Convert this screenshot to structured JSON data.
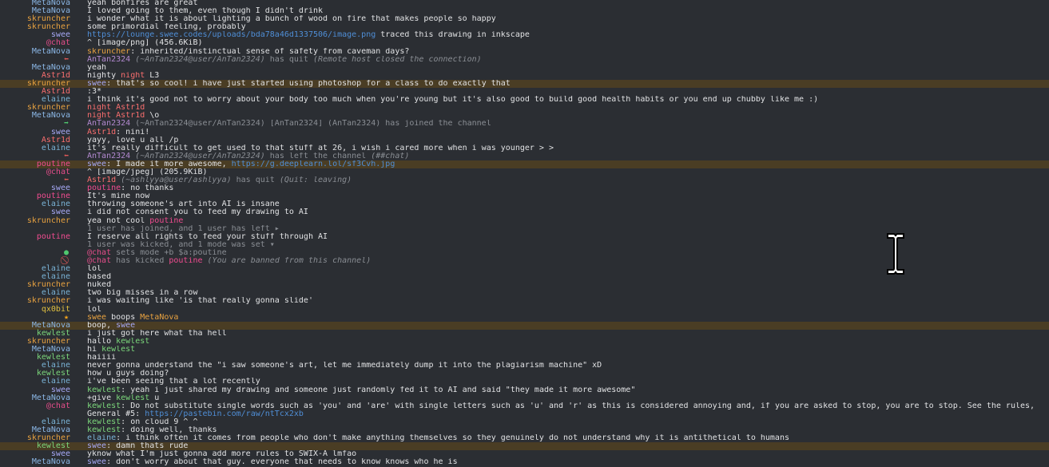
{
  "messages": [
    {
      "nick": "MetaNova",
      "nc": "c-metanova",
      "parts": [
        {
          "t": "yeah bonfires are great"
        }
      ]
    },
    {
      "nick": "MetaNova",
      "nc": "c-metanova",
      "parts": [
        {
          "t": "I loved going to them, even though I didn't drink"
        }
      ]
    },
    {
      "nick": "skruncher",
      "nc": "c-skruncher",
      "parts": [
        {
          "t": "i wonder what it is about lighting a bunch of wood on fire that makes people so happy"
        }
      ]
    },
    {
      "nick": "skruncher",
      "nc": "c-skruncher",
      "parts": [
        {
          "t": "some primordial feeling, probably"
        }
      ]
    },
    {
      "nick": "swee",
      "nc": "c-swee",
      "parts": [
        {
          "t": "https://lounge.swee.codes/uploads/bda78a46d1337506/image.png",
          "c": "url"
        },
        {
          "t": " traced this drawing in inkscape"
        }
      ]
    },
    {
      "nick": "@chat",
      "nc": "c-chat",
      "parts": [
        {
          "t": "^ [image/png] (456.6KiB)"
        }
      ]
    },
    {
      "nick": "MetaNova",
      "nc": "c-metanova",
      "parts": [
        {
          "t": "skruncher",
          "c": "c-skruncher"
        },
        {
          "t": ": inherited/instinctual sense of safety from caveman days?"
        }
      ]
    },
    {
      "icon": "quit",
      "iconName": "quit-icon",
      "parts": [
        {
          "t": "AnTan2324",
          "c": "c-antan"
        },
        {
          "t": " (~AnTan2324@user/AnTan2324)",
          "c": "status-i"
        },
        {
          "t": " has quit ",
          "c": "status"
        },
        {
          "t": "(Remote host closed the connection)",
          "c": "status-i"
        }
      ]
    },
    {
      "nick": "MetaNova",
      "nc": "c-metanova",
      "parts": [
        {
          "t": "yeah"
        }
      ]
    },
    {
      "nick": "Astr1d",
      "nc": "c-astr",
      "parts": [
        {
          "t": "nighty "
        },
        {
          "t": "night",
          "c": "c-astr"
        },
        {
          "t": " L3"
        }
      ]
    },
    {
      "nick": "skruncher",
      "nc": "c-skruncher",
      "hl": true,
      "parts": [
        {
          "t": "swee",
          "c": "c-swee"
        },
        {
          "t": ": that's so cool! i have just started using photoshop for a class to do exactly that"
        }
      ]
    },
    {
      "nick": "Astr1d",
      "nc": "c-astr",
      "parts": [
        {
          "t": ":3*"
        }
      ]
    },
    {
      "nick": "elaine",
      "nc": "c-elaine",
      "parts": [
        {
          "t": "i think it's good not to worry about your body too much when you're young but it's also good to build good health habits or you end up chubby like me :)"
        }
      ]
    },
    {
      "nick": "skruncher",
      "nc": "c-skruncher",
      "parts": [
        {
          "t": "night ",
          "c": "c-astr"
        },
        {
          "t": "Astr1d",
          "c": "c-astr"
        }
      ]
    },
    {
      "nick": "MetaNova",
      "nc": "c-metanova",
      "parts": [
        {
          "t": "night ",
          "c": "c-astr"
        },
        {
          "t": "Astr1d",
          "c": "c-astr"
        },
        {
          "t": " \\o"
        }
      ]
    },
    {
      "icon": "join",
      "iconName": "join-icon",
      "parts": [
        {
          "t": "AnTan2324",
          "c": "c-antan"
        },
        {
          "t": " (~AnTan2324@user/AnTan2324) [AnTan2324] (AnTan2324) has joined the channel",
          "c": "status"
        }
      ]
    },
    {
      "nick": "swee",
      "nc": "c-swee",
      "parts": [
        {
          "t": "Astr1d",
          "c": "c-astr"
        },
        {
          "t": ": nini!"
        }
      ]
    },
    {
      "nick": "Astr1d",
      "nc": "c-astr",
      "parts": [
        {
          "t": "yayy, love u all /p"
        }
      ]
    },
    {
      "nick": "elaine",
      "nc": "c-elaine",
      "parts": [
        {
          "t": "it's really difficult to get used to that stuff at 26, i wish i cared more when i was younger > >"
        }
      ]
    },
    {
      "icon": "quit",
      "iconName": "part-icon",
      "parts": [
        {
          "t": "AnTan2324",
          "c": "c-antan"
        },
        {
          "t": " (~AnTan2324@user/AnTan2324)",
          "c": "status-i"
        },
        {
          "t": " has left the channel ",
          "c": "status"
        },
        {
          "t": "(##chat)",
          "c": "status-i"
        }
      ]
    },
    {
      "nick": "poutine",
      "nc": "c-poutine",
      "hl": true,
      "parts": [
        {
          "t": "swee",
          "c": "c-swee"
        },
        {
          "t": ": I made it more awesome, "
        },
        {
          "t": "https://g.deeplearn.lol/sf3Cvh.jpg",
          "c": "url"
        }
      ]
    },
    {
      "nick": "@chat",
      "nc": "c-chat",
      "parts": [
        {
          "t": "^ [image/jpeg] (205.9KiB)"
        }
      ]
    },
    {
      "icon": "quit",
      "iconName": "quit-icon",
      "parts": [
        {
          "t": "Astr1d",
          "c": "c-astr"
        },
        {
          "t": " (~ashlyya@user/ashlyya)",
          "c": "status-i"
        },
        {
          "t": " has quit ",
          "c": "status"
        },
        {
          "t": "(Quit: leaving)",
          "c": "status-i"
        }
      ]
    },
    {
      "nick": "swee",
      "nc": "c-swee",
      "parts": [
        {
          "t": "poutine",
          "c": "c-poutine"
        },
        {
          "t": ": no thanks"
        }
      ]
    },
    {
      "nick": "poutine",
      "nc": "c-poutine",
      "parts": [
        {
          "t": "It's mine now"
        }
      ]
    },
    {
      "nick": "elaine",
      "nc": "c-elaine",
      "parts": [
        {
          "t": "throwing someone's art into AI is insane"
        }
      ]
    },
    {
      "nick": "swee",
      "nc": "c-swee",
      "parts": [
        {
          "t": "i did not consent you to feed my drawing to AI"
        }
      ]
    },
    {
      "nick": "skruncher",
      "nc": "c-skruncher",
      "parts": [
        {
          "t": "yea not cool "
        },
        {
          "t": "poutine",
          "c": "c-poutine"
        }
      ]
    },
    {
      "parts": [
        {
          "t": "1 user has joined, and 1 user has left ▸",
          "c": "status"
        }
      ]
    },
    {
      "nick": "poutine",
      "nc": "c-poutine",
      "parts": [
        {
          "t": "I reserve all rights to feed your stuff through AI"
        }
      ]
    },
    {
      "parts": [
        {
          "t": "1 user was kicked, and 1 mode was set ▾",
          "c": "status"
        }
      ]
    },
    {
      "icon": "info",
      "iconName": "mode-icon",
      "parts": [
        {
          "t": "@chat",
          "c": "c-chat"
        },
        {
          "t": " sets mode +b $a:poutine",
          "c": "status"
        }
      ]
    },
    {
      "icon": "kick",
      "iconName": "kick-icon",
      "parts": [
        {
          "t": "@chat",
          "c": "c-chat"
        },
        {
          "t": " has kicked ",
          "c": "status"
        },
        {
          "t": "poutine",
          "c": "c-poutine"
        },
        {
          "t": " (You are banned from this channel)",
          "c": "status-i"
        }
      ]
    },
    {
      "nick": "elaine",
      "nc": "c-elaine",
      "parts": [
        {
          "t": "lol"
        }
      ]
    },
    {
      "nick": "elaine",
      "nc": "c-elaine",
      "parts": [
        {
          "t": "based"
        }
      ]
    },
    {
      "nick": "skruncher",
      "nc": "c-skruncher",
      "parts": [
        {
          "t": "nuked"
        }
      ]
    },
    {
      "nick": "elaine",
      "nc": "c-elaine",
      "parts": [
        {
          "t": "two big misses in a row"
        }
      ]
    },
    {
      "nick": "skruncher",
      "nc": "c-skruncher",
      "parts": [
        {
          "t": "i was waiting like 'is that really gonna slide'"
        }
      ]
    },
    {
      "nick": "qx0bit",
      "nc": "c-qx",
      "parts": [
        {
          "t": "lol"
        }
      ]
    },
    {
      "icon": "star",
      "iconName": "star-icon",
      "parts": [
        {
          "t": "swee",
          "c": "c-skruncher"
        },
        {
          "t": " boops "
        },
        {
          "t": "MetaNova",
          "c": "c-skruncher"
        }
      ]
    },
    {
      "nick": "MetaNova",
      "nc": "c-metanova",
      "hl": true,
      "parts": [
        {
          "t": "boop, "
        },
        {
          "t": "swee",
          "c": "c-swee"
        }
      ]
    },
    {
      "nick": "kewlest",
      "nc": "c-kewlest",
      "parts": [
        {
          "t": "i just got here what tha hell"
        }
      ]
    },
    {
      "nick": "skruncher",
      "nc": "c-skruncher",
      "parts": [
        {
          "t": "hallo "
        },
        {
          "t": "kewlest",
          "c": "c-kewlest"
        }
      ]
    },
    {
      "nick": "MetaNova",
      "nc": "c-metanova",
      "parts": [
        {
          "t": "hi "
        },
        {
          "t": "kewlest",
          "c": "c-kewlest"
        }
      ]
    },
    {
      "nick": "kewlest",
      "nc": "c-kewlest",
      "parts": [
        {
          "t": "haiiii"
        }
      ]
    },
    {
      "nick": "elaine",
      "nc": "c-elaine",
      "parts": [
        {
          "t": "never gonna understand the \"i saw someone's art, let me immediately dump it into the plagiarism machine\" xD"
        }
      ]
    },
    {
      "nick": "kewlest",
      "nc": "c-kewlest",
      "parts": [
        {
          "t": "how u guys doing?"
        }
      ]
    },
    {
      "nick": "elaine",
      "nc": "c-elaine",
      "parts": [
        {
          "t": "i've been seeing that a lot recently"
        }
      ]
    },
    {
      "nick": "swee",
      "nc": "c-swee",
      "parts": [
        {
          "t": "kewlest",
          "c": "c-kewlest"
        },
        {
          "t": ": yeah i just shared my drawing and someone just randomly fed it to AI and said \"they made it more awesome\""
        }
      ]
    },
    {
      "nick": "MetaNova",
      "nc": "c-metanova",
      "parts": [
        {
          "t": "+give "
        },
        {
          "t": "kewlest",
          "c": "c-kewlest"
        },
        {
          "t": " u"
        }
      ]
    },
    {
      "nick": "@chat",
      "nc": "c-chat",
      "parts": [
        {
          "t": "kewlest",
          "c": "c-kewlest"
        },
        {
          "t": ": Do not substitute single words such as 'you' and 'are' with single letters such as 'u' and 'r' as this is considered annoying and, if you are asked to stop, you are to stop. See the rules,"
        }
      ]
    },
    {
      "parts": [
        {
          "t": "General #5: "
        },
        {
          "t": "https://pastebin.com/raw/ntTcx2xb",
          "c": "url"
        }
      ]
    },
    {
      "nick": "elaine",
      "nc": "c-elaine",
      "parts": [
        {
          "t": "kewlest",
          "c": "c-kewlest"
        },
        {
          "t": ": on cloud 9 ^ ^"
        }
      ]
    },
    {
      "nick": "MetaNova",
      "nc": "c-metanova",
      "parts": [
        {
          "t": "kewlest",
          "c": "c-kewlest"
        },
        {
          "t": ": doing well, thanks"
        }
      ]
    },
    {
      "nick": "skruncher",
      "nc": "c-skruncher",
      "parts": [
        {
          "t": "elaine",
          "c": "c-elaine"
        },
        {
          "t": ": i think often it comes from people who don't make anything themselves so they genuinely do not understand why it is antithetical to humans"
        }
      ]
    },
    {
      "nick": "kewlest",
      "nc": "c-kewlest",
      "hl": true,
      "parts": [
        {
          "t": "swee",
          "c": "c-swee"
        },
        {
          "t": ": damn thats rude"
        }
      ]
    },
    {
      "nick": "swee",
      "nc": "c-swee",
      "parts": [
        {
          "t": "yknow what I'm just gonna add more rules to SWIX-A lmfao"
        }
      ]
    },
    {
      "nick": "MetaNova",
      "nc": "c-metanova",
      "parts": [
        {
          "t": "swee",
          "c": "c-swee"
        },
        {
          "t": ": don't worry about that guy. everyone that needs to know knows who he is"
        }
      ]
    }
  ],
  "icons": {
    "quit": "⬅",
    "join": "➡",
    "info": "●",
    "kick": "⃠",
    "star": "★"
  }
}
